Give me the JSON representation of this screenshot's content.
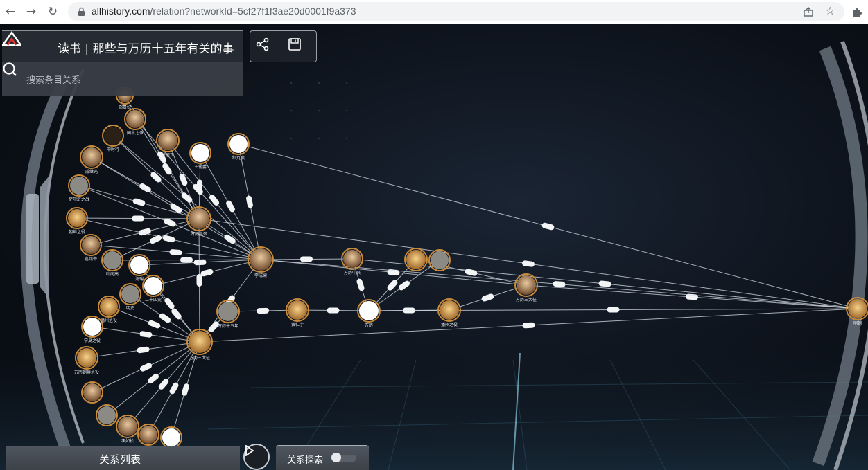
{
  "browser": {
    "url_host": "allhistory.com",
    "url_path": "/relation?networkId=5cf27f1f3ae20d0001f9a373"
  },
  "panel": {
    "title": "读书 | 那些与万历十五年有关的事",
    "search_placeholder": "搜索条目关系"
  },
  "bottom": {
    "list_label": "关系列表",
    "explore_label": "关系探索"
  },
  "graph": {
    "nodes": [
      {
        "label": "郑贵妃"
      },
      {
        "label": "国本之争"
      },
      {
        "label": "申时行"
      },
      {
        "label": "张居正"
      },
      {
        "label": "王锡爵"
      },
      {
        "label": "红丸案"
      },
      {
        "label": "戚继光"
      },
      {
        "label": "萨尔浒之战"
      },
      {
        "label": "万历皇帝"
      },
      {
        "label": "朝鲜之役"
      },
      {
        "label": "嘉靖帝"
      },
      {
        "label": "李成梁"
      },
      {
        "label": "叶向高"
      },
      {
        "label": "海瑞"
      },
      {
        "label": "二十四史"
      },
      {
        "label": "明史"
      },
      {
        "label": "万历十五年"
      },
      {
        "label": "黄仁宇"
      },
      {
        "label": "万历"
      },
      {
        "label": "万历中兴"
      },
      {
        "label": "明朝"
      },
      {
        "label": "宁夏之役"
      },
      {
        "label": "播州之役"
      },
      {
        "label": "万历三大征"
      },
      {
        "label": "丰臣秀吉"
      },
      {
        "label": "李如松"
      },
      {
        "label": "李舜臣"
      },
      {
        "label": "努尔哈赤"
      },
      {
        "label": "万历朝鲜之役"
      },
      {
        "label": "努尔哈赤之战"
      }
    ]
  }
}
